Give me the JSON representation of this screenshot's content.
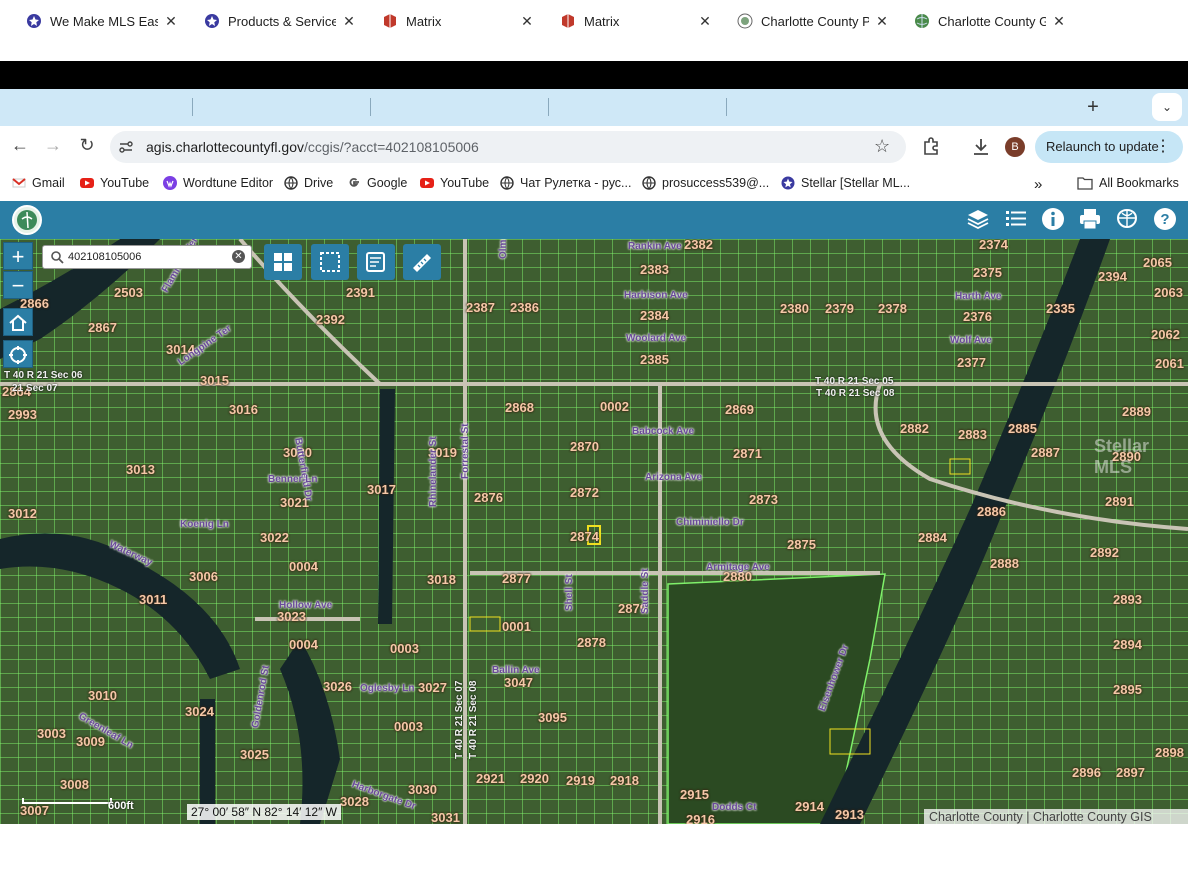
{
  "browser": {
    "tabs": [
      {
        "title": "We Make MLS Easy |",
        "icon": "mls-star-icon",
        "active": false
      },
      {
        "title": "Products & Services",
        "icon": "mls-star-icon",
        "active": false
      },
      {
        "title": "Matrix",
        "icon": "matrix-icon",
        "active": false
      },
      {
        "title": "Matrix",
        "icon": "matrix-icon",
        "active": false
      },
      {
        "title": "Charlotte County Pro",
        "icon": "county-seal-icon",
        "active": false
      },
      {
        "title": "Charlotte County GIS",
        "icon": "globe-icon",
        "active": true
      }
    ],
    "url_host": "agis.charlottecountyfl.gov",
    "url_path": "/ccgis/?acct=402108105006",
    "relaunch_label": "Relaunch to update",
    "avatar_letter": "B",
    "bookmarks": [
      {
        "label": "Gmail",
        "icon": "gmail-icon"
      },
      {
        "label": "YouTube",
        "icon": "youtube-icon"
      },
      {
        "label": "Wordtune Editor",
        "icon": "wordtune-icon"
      },
      {
        "label": "Drive",
        "icon": "globe-icon"
      },
      {
        "label": "Google",
        "icon": "google-icon"
      },
      {
        "label": "YouTube",
        "icon": "youtube-icon"
      },
      {
        "label": "Чат Рулетка - рус...",
        "icon": "globe-icon"
      },
      {
        "label": "prosuccess539@...",
        "icon": "globe-icon"
      },
      {
        "label": "Stellar [Stellar ML...",
        "icon": "mls-star-icon"
      }
    ],
    "all_bookmarks_label": "All Bookmarks",
    "more_chevron": "»"
  },
  "gis": {
    "search_value": "402108105006",
    "coordinates": "27° 00′ 58″ N 82° 14′ 12″ W",
    "scale_label": "600ft",
    "attribution": "Charlotte County | Charlotte County GIS",
    "watermark": "Stellar MLS",
    "colors": {
      "header": "#2b7ea5",
      "parcel_line": "#7ff06a",
      "label": "#f5c8a8",
      "selected": "#f0e020",
      "water": "#1b2a30"
    }
  },
  "map_labels": {
    "blocks": [
      "2382",
      "2374",
      "2065",
      "2503",
      "2391",
      "2383",
      "2375",
      "2394",
      "2063",
      "2866",
      "2387",
      "2386",
      "2380",
      "2379",
      "2378",
      "2376",
      "2335",
      "2867",
      "2392",
      "2384",
      "2062",
      "3014",
      "2385",
      "2377",
      "2061",
      "3015",
      "2864",
      "2993",
      "3016",
      "2868",
      "0002",
      "2869",
      "2889",
      "2882",
      "2883",
      "2885",
      "3020",
      "3019",
      "2870",
      "2871",
      "2887",
      "2890",
      "3013",
      "3017",
      "2876",
      "2872",
      "2873",
      "2891",
      "3012",
      "3021",
      "2886",
      "3022",
      "2874",
      "2875",
      "2884",
      "2892",
      "0004",
      "3006",
      "3018",
      "2877",
      "2880",
      "2888",
      "3011",
      "2879",
      "2893",
      "3023",
      "0001",
      "0004",
      "0003",
      "2878",
      "2894",
      "3010",
      "3026",
      "3027",
      "3047",
      "2895",
      "3024",
      "3095",
      "3009",
      "3003",
      "0003",
      "2898",
      "3025",
      "3008",
      "2921",
      "2920",
      "2919",
      "2918",
      "2896",
      "2897",
      "3007",
      "3030",
      "3028",
      "2915",
      "2914",
      "2913",
      "3031",
      "2916"
    ],
    "streets": [
      "Rankin Ave",
      "Harbison Ave",
      "Woolard Ave",
      "Harth Ave",
      "Wolf Ave",
      "Babcock Ave",
      "Arizona Ave",
      "Chiminiello Dr",
      "Armitage Ave",
      "Butterfield Dr",
      "Benner Ln",
      "Koenig Ln",
      "Hollow Ave",
      "Oglesby Ln",
      "Ballin Ave",
      "Dodds Ct",
      "Eisenhower Dr",
      "Forrestal St",
      "Shell St",
      "Saddle St",
      "Rhinelander St",
      "Olmstead St",
      "Flamingo Ter",
      "Longpine Ter",
      "Goldenrod St",
      "Greenleaf Ln",
      "Harborgate Dr",
      "Waterway"
    ],
    "sections": [
      "T 40 R 21 Sec 06",
      "21 Sec 07",
      "T 40 R 21 Sec 05",
      "T 40 R 21 Sec 08",
      "T 40 R 21 Sec 07",
      "T 40 R 21 Sec 08"
    ]
  }
}
